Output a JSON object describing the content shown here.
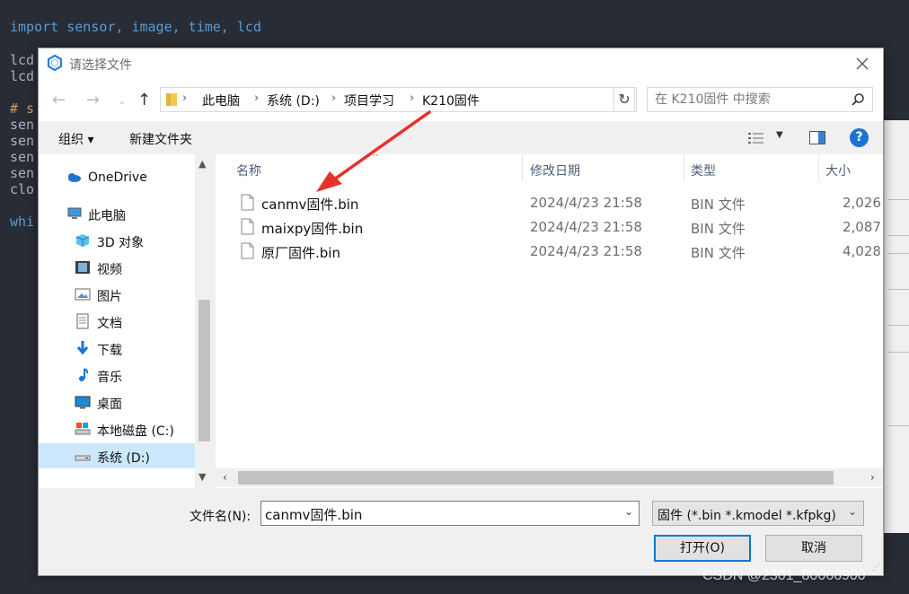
{
  "code_lines": [
    "import sensor, image, time, lcd",
    "lcd",
    "lcd",
    "# s",
    "sen",
    "sen",
    "sen",
    "sen",
    "clo",
    "whi"
  ],
  "dialog": {
    "title": "请选择文件",
    "breadcrumb": [
      "此电脑",
      "系统 (D:)",
      "项目学习",
      "K210固件"
    ],
    "search_placeholder": "在 K210固件 中搜索",
    "toolbar": {
      "organize": "组织 ▾",
      "new_folder": "新建文件夹"
    },
    "sidebar": [
      {
        "label": "OneDrive",
        "icon": "onedrive-icon"
      },
      {
        "label": "此电脑",
        "icon": "computer-icon"
      },
      {
        "label": "3D 对象",
        "icon": "3d-objects-icon"
      },
      {
        "label": "视频",
        "icon": "video-icon"
      },
      {
        "label": "图片",
        "icon": "pictures-icon"
      },
      {
        "label": "文档",
        "icon": "documents-icon"
      },
      {
        "label": "下载",
        "icon": "download-icon"
      },
      {
        "label": "音乐",
        "icon": "music-icon"
      },
      {
        "label": "桌面",
        "icon": "desktop-icon"
      },
      {
        "label": "本地磁盘 (C:)",
        "icon": "drive-icon"
      },
      {
        "label": "系统 (D:)",
        "icon": "drive-icon",
        "selected": true
      }
    ],
    "columns": {
      "name": "名称",
      "modified": "修改日期",
      "type": "类型",
      "size": "大小"
    },
    "files": [
      {
        "name": "canmv固件.bin",
        "modified": "2024/4/23 21:58",
        "type": "BIN 文件",
        "size": "2,026"
      },
      {
        "name": "maixpy固件.bin",
        "modified": "2024/4/23 21:58",
        "type": "BIN 文件",
        "size": "2,087"
      },
      {
        "name": "原厂固件.bin",
        "modified": "2024/4/23 21:58",
        "type": "BIN 文件",
        "size": "4,028"
      }
    ],
    "filename_label": "文件名(N):",
    "filename_value": "canmv固件.bin",
    "filetype_value": "固件 (*.bin *.kmodel *.kfpkg)",
    "open_button": "打开(O)",
    "cancel_button": "取消"
  },
  "watermark": "CSDN @2301_80066900",
  "colors": {
    "accent": "#0078d7",
    "annotation_arrow": "#e8302c",
    "selection": "#cce8ff"
  }
}
